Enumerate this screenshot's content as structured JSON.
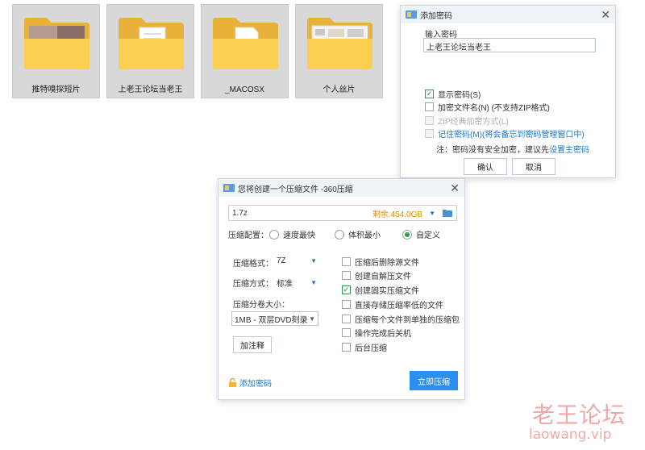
{
  "folders": [
    {
      "name": "推特嗅探短片"
    },
    {
      "name": "上老王论坛当老王"
    },
    {
      "name": "_MACOSX"
    },
    {
      "name": "个人丝片"
    }
  ],
  "password_dialog": {
    "title": "添加密码",
    "input_label": "输入密码",
    "input_value": "上老王论坛当老王",
    "show_password": "显示密码(S)",
    "encrypt_filenames": "加密文件名(N) (不支持ZIP格式)",
    "zip_classic": "ZIP经典加密方式(L)",
    "remember_prefix": "记住密码(M)",
    "remember_suffix": " (将会备忘到密码管理窗口中)",
    "note_prefix": "注：密码没有安全加密，建议先",
    "note_link": "设置主密码",
    "ok_label": "确认",
    "cancel_label": "取消"
  },
  "compress_dialog": {
    "title": "您将创建一个压缩文件 -360压缩",
    "filename": "1.7z",
    "free_space": "剩余:454.0GB",
    "config_label": "压缩配置：",
    "modes": [
      "速度最快",
      "体积最小",
      "自定义"
    ],
    "format_label": "压缩格式：",
    "format_value": "7Z",
    "method_label": "压缩方式：",
    "method_value": "标准",
    "split_label": "压缩分卷大小：",
    "split_value": "1MB  - 双层DVD刻录",
    "comment_button": "加注释",
    "options": [
      {
        "label": "压缩后删除源文件",
        "checked": false
      },
      {
        "label": "创建自解压文件",
        "checked": false
      },
      {
        "label": "创建固实压缩文件",
        "checked": true
      },
      {
        "label": "直接存储压缩率低的文件",
        "checked": false
      },
      {
        "label": "压缩每个文件到单独的压缩包",
        "checked": false
      },
      {
        "label": "操作完成后关机",
        "checked": false
      },
      {
        "label": "后台压缩",
        "checked": false
      }
    ],
    "add_password": "添加密码",
    "compress_now": "立即压缩"
  },
  "watermark": {
    "zh": "老王论坛",
    "en": "laowang.vip"
  },
  "colors": {
    "accent": "#1a78d2",
    "primary_button": "#2b8ff0",
    "free_space": "#e08a00",
    "watermark": "#f0a8a8"
  }
}
